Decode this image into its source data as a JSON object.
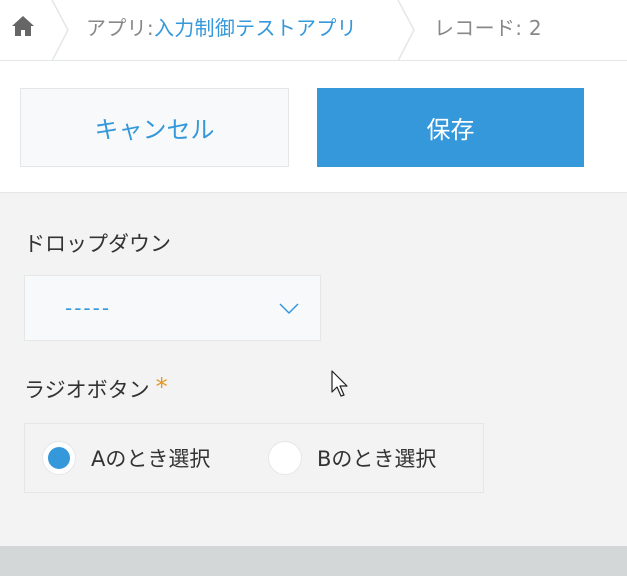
{
  "breadcrumb": {
    "home_icon": "home-icon",
    "app_prefix": "アプリ: ",
    "app_name": "入力制御テストアプリ",
    "record_label": "レコード: 2"
  },
  "toolbar": {
    "cancel_label": "キャンセル",
    "save_label": "保存"
  },
  "form": {
    "dropdown": {
      "label": "ドロップダウン",
      "value": "-----",
      "chevron_icon": "chevron-down-icon"
    },
    "radio": {
      "label": "ラジオボタン",
      "required_mark": "*",
      "options": [
        {
          "label": "Aのとき選択",
          "selected": true
        },
        {
          "label": "Bのとき選択",
          "selected": false
        }
      ]
    }
  },
  "colors": {
    "accent": "#3498db",
    "required": "#e49722",
    "text": "#333333",
    "muted": "#888888",
    "background": "#f3f3f3",
    "border": "#e3e7e8"
  }
}
